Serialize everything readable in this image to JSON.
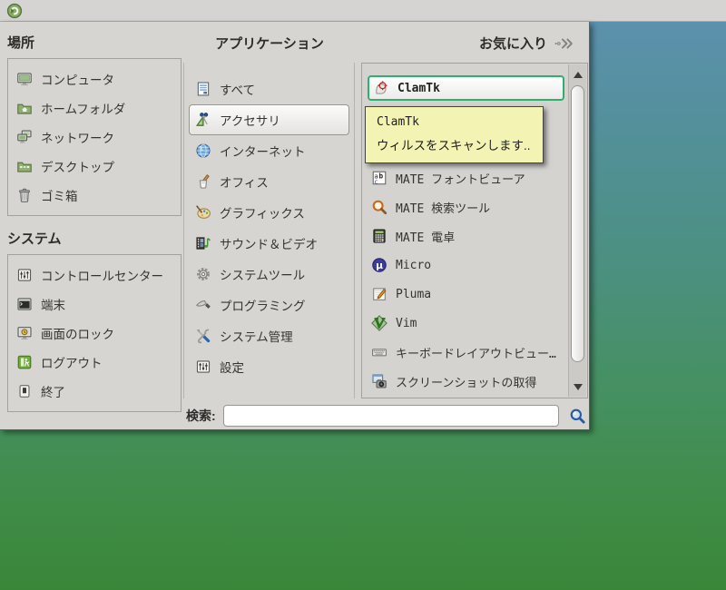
{
  "panel": {
    "logo": "mint-menu-logo"
  },
  "menu": {
    "places": {
      "title": "場所",
      "items": [
        {
          "label": "コンピュータ",
          "icon": "computer-icon"
        },
        {
          "label": "ホームフォルダ",
          "icon": "home-folder-icon"
        },
        {
          "label": "ネットワーク",
          "icon": "network-icon"
        },
        {
          "label": "デスクトップ",
          "icon": "desktop-folder-icon"
        },
        {
          "label": "ゴミ箱",
          "icon": "trash-icon"
        }
      ]
    },
    "system": {
      "title": "システム",
      "items": [
        {
          "label": "コントロールセンター",
          "icon": "control-center-icon"
        },
        {
          "label": "端末",
          "icon": "terminal-icon"
        },
        {
          "label": "画面のロック",
          "icon": "lock-screen-icon"
        },
        {
          "label": "ログアウト",
          "icon": "logout-icon"
        },
        {
          "label": "終了",
          "icon": "quit-icon"
        }
      ]
    },
    "applications": {
      "title": "アプリケーション",
      "categories": [
        {
          "label": "すべて",
          "icon": "all-applications-icon",
          "selected": false
        },
        {
          "label": "アクセサリ",
          "icon": "accessories-icon",
          "selected": true
        },
        {
          "label": "インターネット",
          "icon": "internet-icon",
          "selected": false
        },
        {
          "label": "オフィス",
          "icon": "office-icon",
          "selected": false
        },
        {
          "label": "グラフィックス",
          "icon": "graphics-icon",
          "selected": false
        },
        {
          "label": "サウンド＆ビデオ",
          "icon": "sound-video-icon",
          "selected": false
        },
        {
          "label": "システムツール",
          "icon": "system-tools-icon",
          "selected": false
        },
        {
          "label": "プログラミング",
          "icon": "programming-icon",
          "selected": false
        },
        {
          "label": "システム管理",
          "icon": "system-admin-icon",
          "selected": false
        },
        {
          "label": "設定",
          "icon": "settings-icon",
          "selected": false
        }
      ]
    },
    "favorites": {
      "label": "お気に入り",
      "icon": "favorites-arrow-icon"
    },
    "apps": {
      "items": [
        {
          "label": "ClamTk",
          "icon": "clamtk-icon",
          "selected": true
        },
        {
          "label": "MATE フォントビューア",
          "icon": "font-viewer-icon",
          "selected": false
        },
        {
          "label": "MATE 検索ツール",
          "icon": "search-tool-icon",
          "selected": false
        },
        {
          "label": "MATE 電卓",
          "icon": "calculator-icon",
          "selected": false
        },
        {
          "label": "Micro",
          "icon": "micro-icon",
          "selected": false
        },
        {
          "label": "Pluma",
          "icon": "pluma-icon",
          "selected": false
        },
        {
          "label": "Vim",
          "icon": "vim-icon",
          "selected": false
        },
        {
          "label": "キーボードレイアウトビュー…",
          "icon": "keyboard-icon",
          "selected": false
        },
        {
          "label": "スクリーンショットの取得",
          "icon": "screenshot-icon",
          "selected": false
        }
      ]
    },
    "tooltip": {
      "title": "ClamTk",
      "description": "ウィルスをスキャンします.."
    },
    "search": {
      "label": "検索:",
      "value": ""
    }
  },
  "colors": {
    "selection_green": "#2eb06c",
    "tooltip_bg": "#f3f3b4",
    "panel_gray": "#d5d4d2",
    "desktop_top": "#5e91b0",
    "desktop_bottom": "#3a8639"
  }
}
